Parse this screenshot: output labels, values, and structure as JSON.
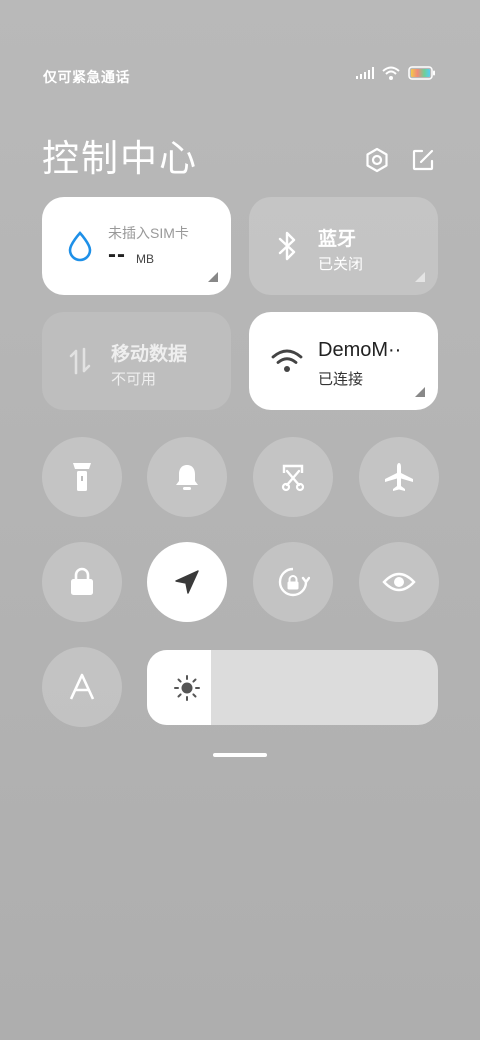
{
  "status_bar": {
    "carrier_text": "仅可紧急通话",
    "icons": [
      "signal-icon",
      "wifi-icon",
      "battery-icon"
    ]
  },
  "header": {
    "title": "控制中心",
    "icons": [
      "settings-icon",
      "edit-icon"
    ]
  },
  "tiles": {
    "data_usage": {
      "label": "未插入SIM卡",
      "value": "--",
      "unit": "MB",
      "icon": "water-drop-icon"
    },
    "bluetooth": {
      "label": "蓝牙",
      "status": "已关闭",
      "icon": "bluetooth-icon"
    },
    "mobile_data": {
      "label": "移动数据",
      "status": "不可用",
      "icon": "mobile-data-icon"
    },
    "wifi": {
      "label": "DemoM··",
      "status": "已连接",
      "icon": "wifi-icon"
    }
  },
  "toggles": [
    {
      "name": "flashlight",
      "icon": "flashlight-icon",
      "active": false
    },
    {
      "name": "mute",
      "icon": "bell-icon",
      "active": false
    },
    {
      "name": "screenshot",
      "icon": "scissors-screenshot-icon",
      "active": false
    },
    {
      "name": "airplane-mode",
      "icon": "airplane-icon",
      "active": false
    },
    {
      "name": "lock-screen",
      "icon": "lock-icon",
      "active": false
    },
    {
      "name": "location",
      "icon": "location-arrow-icon",
      "active": true
    },
    {
      "name": "auto-rotate",
      "icon": "rotation-lock-icon",
      "active": false
    },
    {
      "name": "reading-mode",
      "icon": "eye-icon",
      "active": false
    },
    {
      "name": "auto-brightness",
      "icon": "letter-a-icon",
      "active": false
    }
  ],
  "brightness": {
    "level": 0.22,
    "icon": "sun-icon"
  },
  "colors": {
    "accent_blue": "#1e90e8",
    "dark_icon": "#3a3a3a",
    "tile_white": "#ffffff"
  }
}
